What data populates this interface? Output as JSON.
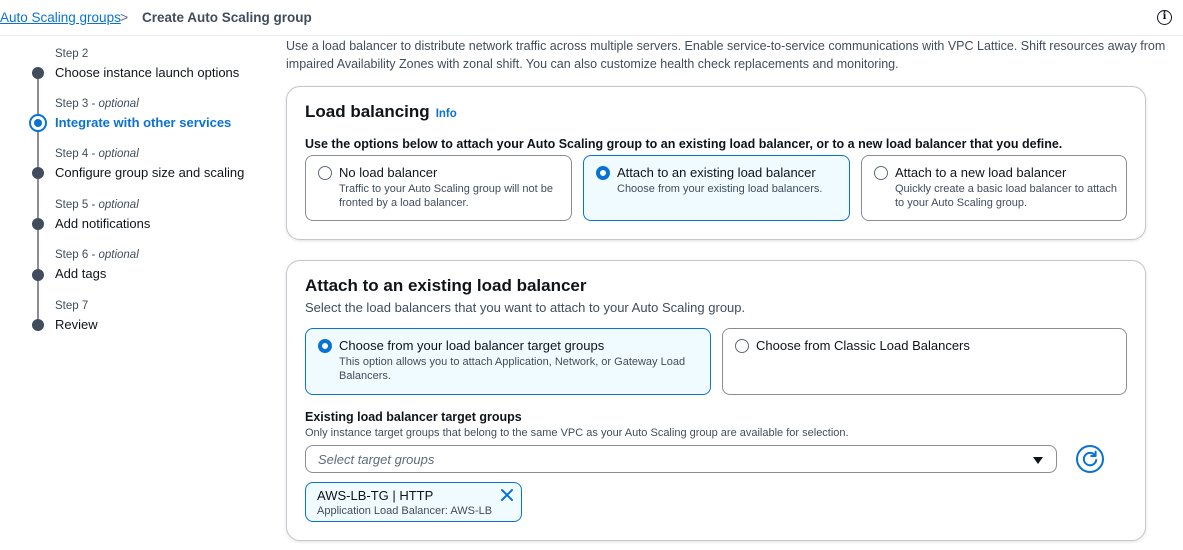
{
  "breadcrumb": {
    "parent": "Auto Scaling groups",
    "separator": ">",
    "current": "Create Auto Scaling group"
  },
  "header": {
    "info_icon": "info-circle-icon"
  },
  "steps": [
    {
      "label": "Step 2",
      "optional": "",
      "title": "Choose instance launch options",
      "state": "done"
    },
    {
      "label": "Step 3 - ",
      "optional": "optional",
      "title": "Integrate with other services",
      "state": "active"
    },
    {
      "label": "Step 4 - ",
      "optional": "optional",
      "title": "Configure group size and scaling",
      "state": "pending"
    },
    {
      "label": "Step 5 - ",
      "optional": "optional",
      "title": "Add notifications",
      "state": "pending"
    },
    {
      "label": "Step 6 - ",
      "optional": "optional",
      "title": "Add tags",
      "state": "pending"
    },
    {
      "label": "Step 7",
      "optional": "",
      "title": "Review",
      "state": "pending"
    }
  ],
  "intro": "Use a load balancer to distribute network traffic across multiple servers. Enable service-to-service communications with VPC Lattice. Shift resources away from impaired Availability Zones with zonal shift. You can also customize health check replacements and monitoring.",
  "load_balancing": {
    "title": "Load balancing",
    "info": "Info",
    "description": "Use the options below to attach your Auto Scaling group to an existing load balancer, or to a new load balancer that you define.",
    "options": [
      {
        "title": "No load balancer",
        "desc": "Traffic to your Auto Scaling group will not be fronted by a load balancer.",
        "selected": false
      },
      {
        "title": "Attach to an existing load balancer",
        "desc": "Choose from your existing load balancers.",
        "selected": true
      },
      {
        "title": "Attach to a new load balancer",
        "desc": "Quickly create a basic load balancer to attach to your Auto Scaling group.",
        "selected": false
      }
    ]
  },
  "attach_existing": {
    "title": "Attach to an existing load balancer",
    "description": "Select the load balancers that you want to attach to your Auto Scaling group.",
    "options": [
      {
        "title": "Choose from your load balancer target groups",
        "desc": "This option allows you to attach Application, Network, or Gateway Load Balancers.",
        "selected": true
      },
      {
        "title": "Choose from Classic Load Balancers",
        "desc": "",
        "selected": false
      }
    ],
    "target_groups": {
      "label": "Existing load balancer target groups",
      "hint": "Only instance target groups that belong to the same VPC as your Auto Scaling group are available for selection.",
      "placeholder": "Select target groups",
      "token_title": "AWS-LB-TG | HTTP",
      "token_sub": "Application Load Balancer: AWS-LB"
    }
  },
  "colors": {
    "accent": "#0972d3",
    "selected_bg": "#f0fbff",
    "text": "#0f141a",
    "muted": "#414d5c"
  }
}
